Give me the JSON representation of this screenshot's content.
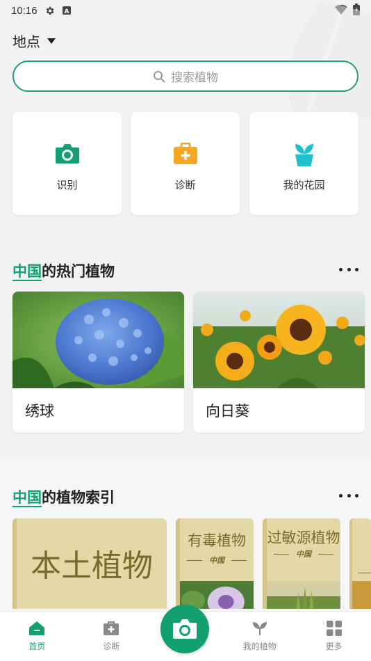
{
  "status_bar": {
    "time": "10:16"
  },
  "location": {
    "label": "地点"
  },
  "search": {
    "placeholder": "搜索植物"
  },
  "quick_actions": [
    {
      "label": "识别",
      "icon": "camera-icon",
      "color": "#12a06e"
    },
    {
      "label": "诊断",
      "icon": "first-aid-icon",
      "color": "#f5a623"
    },
    {
      "label": "我的花园",
      "icon": "plant-pot-icon",
      "color": "#1fbfcf"
    }
  ],
  "popular": {
    "highlight": "中国",
    "rest": "的热门植物",
    "plants": [
      {
        "name": "绣球",
        "image": "hydrangea-photo"
      },
      {
        "name": "向日葵",
        "image": "sunflower-photo"
      }
    ]
  },
  "index": {
    "highlight": "中国",
    "rest": "的植物索引",
    "books": [
      {
        "title": "本土植物"
      },
      {
        "title": "有毒植物",
        "country": "中国"
      },
      {
        "title": "过敏源植物",
        "country": "中国"
      }
    ]
  },
  "bottom_nav": {
    "items": [
      {
        "label": "首页",
        "icon": "home-icon",
        "active": true
      },
      {
        "label": "诊断",
        "icon": "first-aid-icon"
      },
      {
        "label": "我的植物",
        "icon": "sprout-icon"
      },
      {
        "label": "更多",
        "icon": "grid-icon"
      }
    ],
    "camera_icon": "camera-icon"
  },
  "colors": {
    "accent": "#12a06e",
    "diagnose": "#f5a623",
    "garden": "#1fbfcf",
    "book": "#e4d8a6"
  }
}
